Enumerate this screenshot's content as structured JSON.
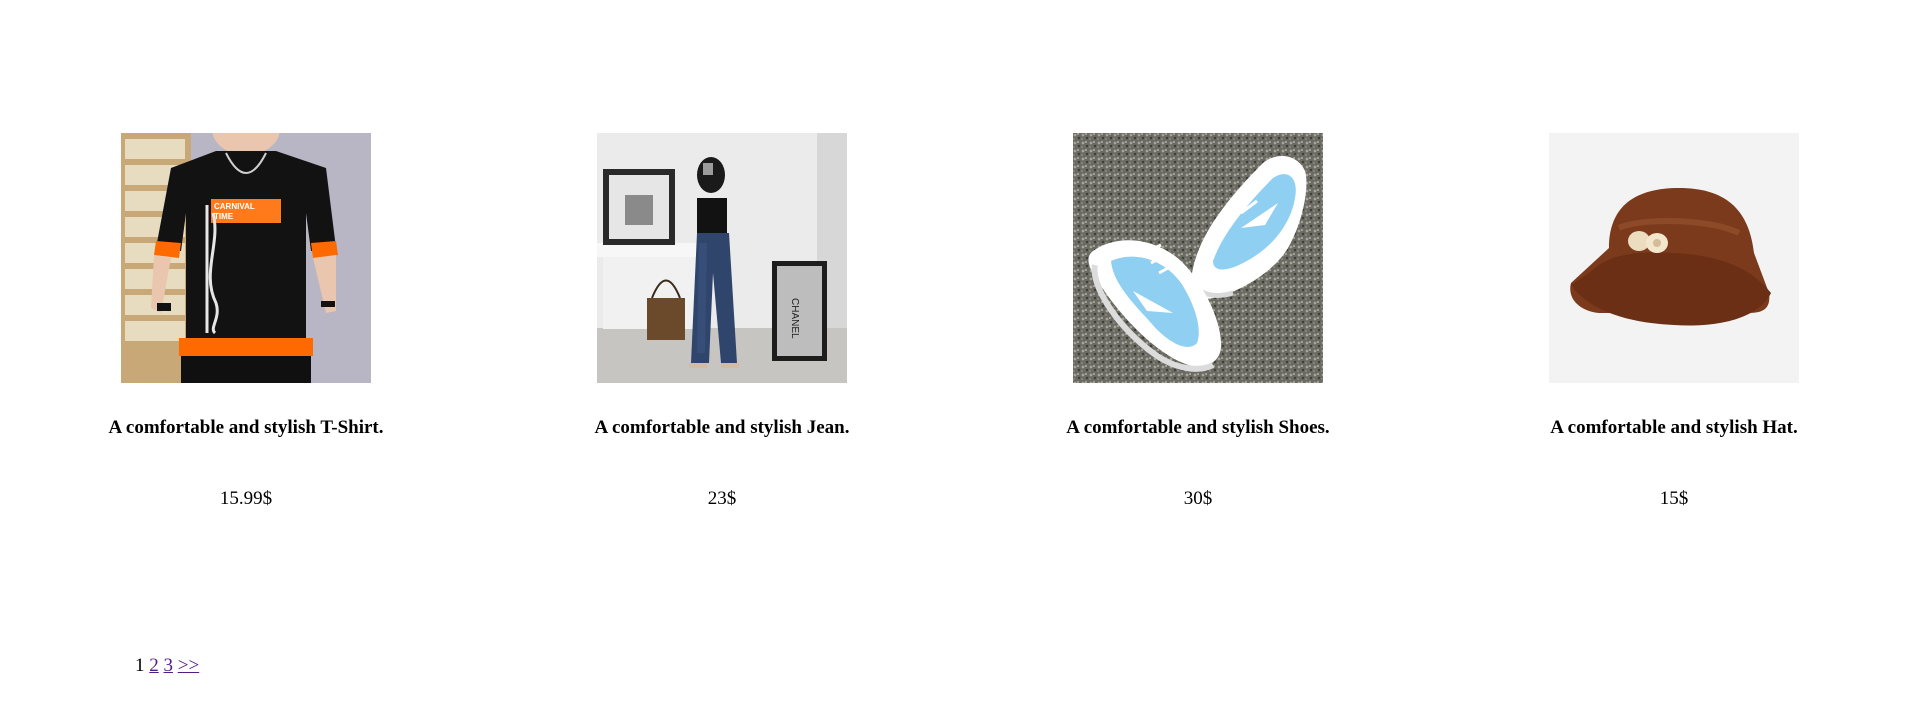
{
  "products": [
    {
      "title": "A comfortable and stylish T-Shirt.",
      "price": "15.99$",
      "image": "t-shirt-photo"
    },
    {
      "title": "A comfortable and stylish Jean.",
      "price": "23$",
      "image": "jeans-photo"
    },
    {
      "title": "A comfortable and stylish Shoes.",
      "price": "30$",
      "image": "sneakers-photo"
    },
    {
      "title": "A comfortable and stylish Hat.",
      "price": "15$",
      "image": "bucket-hat-photo"
    }
  ],
  "pagination": {
    "current": "1",
    "pages": [
      "2",
      "3"
    ],
    "next": ">>"
  },
  "colors": {
    "link_visited": "#551a8b",
    "text": "#000000"
  }
}
